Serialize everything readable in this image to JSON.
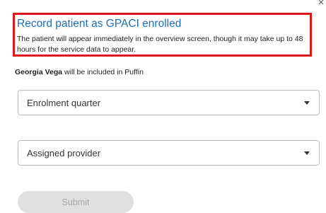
{
  "dialog": {
    "close_glyph": "×",
    "title": "Record patient as GPACI enrolled",
    "description": "The patient will appear immediately in the overview screen, though it may take up to 48 hours for the service data to appear.",
    "patient_name": "Georgia Vega",
    "included_text": " will be included in Puffin",
    "fields": {
      "enrolment_quarter": "Enrolment quarter",
      "assigned_provider": "Assigned provider"
    },
    "submit_label": "Submit",
    "submit_disabled": true
  },
  "colors": {
    "title": "#1c6fb3",
    "highlight_border": "#e0181e",
    "button_disabled_bg": "#e0e0e0",
    "button_disabled_text": "#a6a6a6"
  },
  "icons": {
    "close": "close-icon",
    "dropdown": "chevron-down-icon"
  }
}
